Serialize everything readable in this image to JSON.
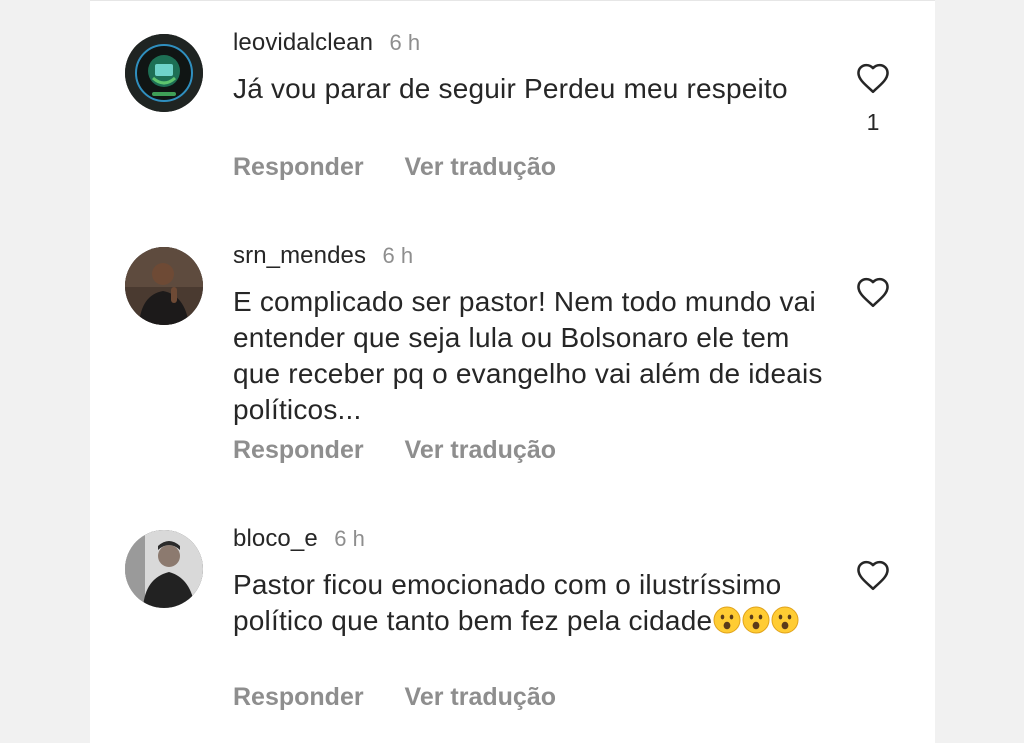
{
  "comments": [
    {
      "username": "leovidalclean",
      "time": "6 h",
      "text": "Já vou parar de seguir  Perdeu meu respeito",
      "reply_label": "Responder",
      "translate_label": "Ver tradução",
      "likes": "1"
    },
    {
      "username": "srn_mendes",
      "time": "6 h",
      "text": "E complicado ser pastor! Nem todo mundo vai entender que seja lula ou Bolsonaro ele tem que receber pq o evangelho vai além de ideais políticos...",
      "reply_label": "Responder",
      "translate_label": "Ver tradução"
    },
    {
      "username": "bloco_e",
      "time": "6 h",
      "text": "Pastor ficou emocionado com o ilustríssimo político que tanto bem fez pela cidade",
      "emojis": [
        "hushed-face",
        "hushed-face",
        "hushed-face"
      ],
      "reply_label": "Responder",
      "translate_label": "Ver tradução"
    }
  ],
  "icons": {
    "like": "heart-outline-icon",
    "emoji": "hushed-face-emoji"
  },
  "colors": {
    "text": "#262626",
    "secondary": "#8e8e8e",
    "background": "#ffffff",
    "page": "#f1f1f1"
  }
}
